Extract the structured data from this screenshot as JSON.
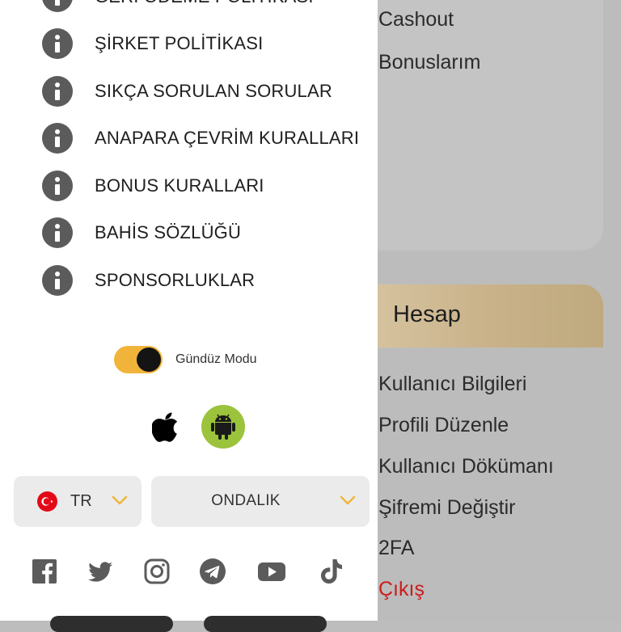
{
  "background_page": {
    "links_top": [
      "Cashout",
      "Bonuslarım"
    ],
    "section": {
      "title": "Hesap",
      "links": [
        "Kullanıcı Bilgileri",
        "Profili Düzenle",
        "Kullanıcı Dökümanı",
        "Şifremi Değiştir",
        "2FA"
      ],
      "logout": "Çıkış"
    }
  },
  "drawer": {
    "menu_items": [
      {
        "label": "GERİ ÖDEME POLİTİKASI",
        "icon": "info-icon"
      },
      {
        "label": "ŞİRKET POLİTİKASI",
        "icon": "info-icon"
      },
      {
        "label": "SIKÇA SORULAN SORULAR",
        "icon": "info-icon"
      },
      {
        "label": "ANAPARA ÇEVRİM KURALLARI",
        "icon": "info-icon"
      },
      {
        "label": "BONUS KURALLARI",
        "icon": "info-icon"
      },
      {
        "label": "BAHİS SÖZLÜĞÜ",
        "icon": "info-icon"
      },
      {
        "label": "SPONSORLUKLAR",
        "icon": "info-icon"
      }
    ],
    "theme_toggle": {
      "label": "Gündüz Modu",
      "on": true,
      "color": "#f1b43b"
    },
    "apps": {
      "ios_icon": "apple-icon",
      "android_icon": "android-icon",
      "android_color": "#9bc33c"
    },
    "language_select": {
      "value": "TR",
      "flag_icon": "turkey-flag-icon"
    },
    "odds_select": {
      "value": "ONDALIK"
    },
    "accent_color": "#f1b43b",
    "social_icons": [
      "facebook-icon",
      "twitter-icon",
      "instagram-icon",
      "telegram-icon",
      "youtube-icon",
      "tiktok-icon"
    ]
  },
  "colors": {
    "logout": "#cc1b1b",
    "icon_gray": "#5b5b5b"
  }
}
